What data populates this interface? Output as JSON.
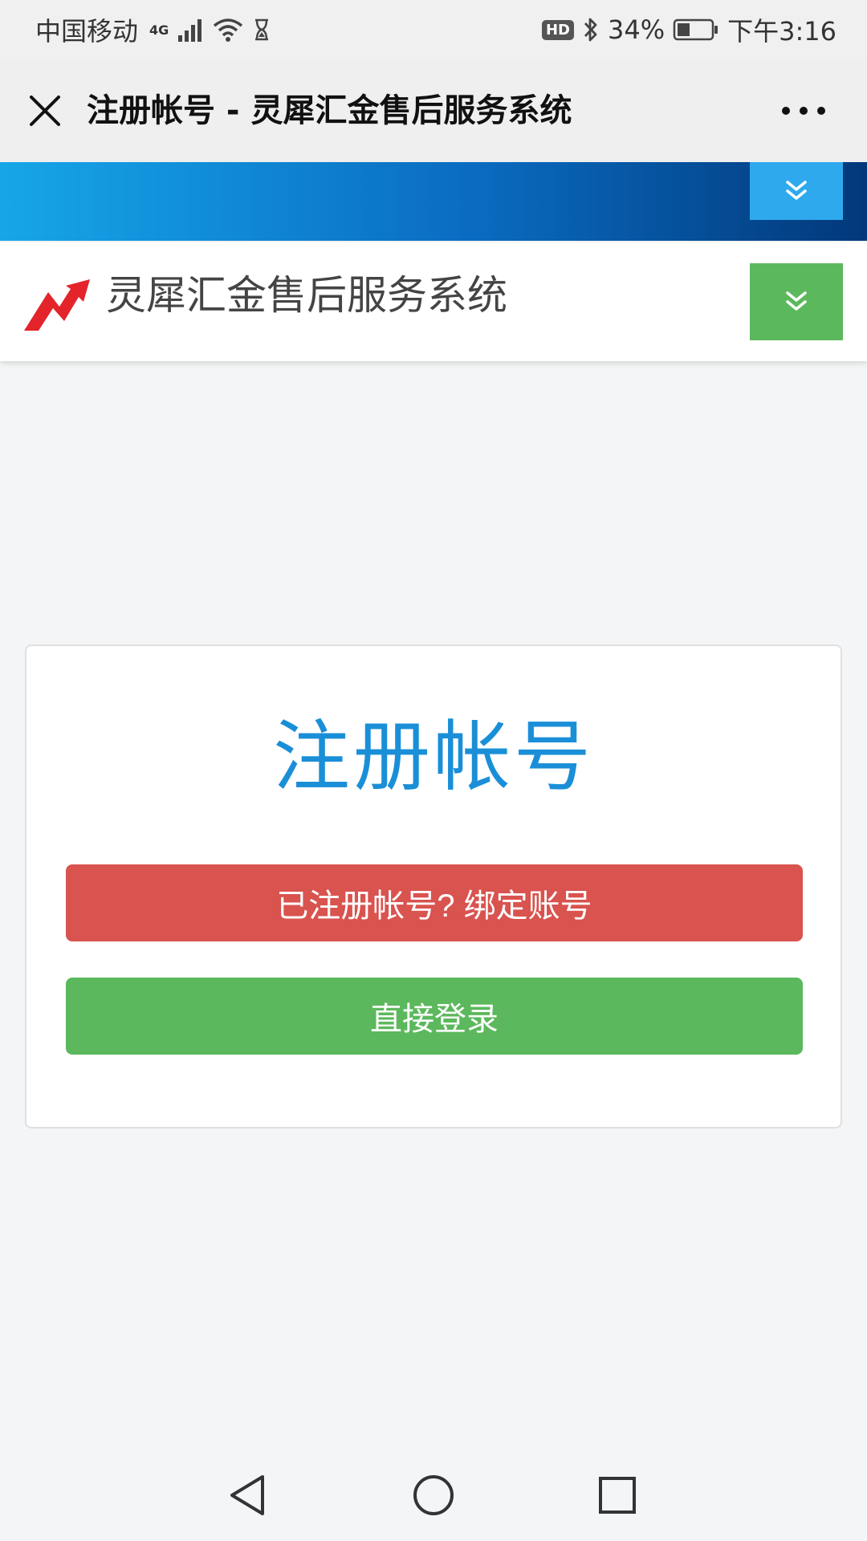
{
  "status_bar": {
    "carrier": "中国移动",
    "network": "4G",
    "hd": "HD",
    "battery": "34%",
    "time": "下午3:16",
    "icons": [
      "signal-icon",
      "wifi-icon",
      "hourglass-icon",
      "bluetooth-icon",
      "battery-icon"
    ]
  },
  "nav": {
    "title": "注册帐号 - 灵犀汇金售后服务系统",
    "close_icon": "close-icon",
    "more_icon": "more-icon"
  },
  "header": {
    "site_name": "灵犀汇金售后服务系统",
    "logo_color": "#e3242b",
    "toggle_color": "#5cb85c"
  },
  "card": {
    "title": "注册帐号",
    "title_color": "#1a8fd8",
    "bind_button": "已注册帐号? 绑定账号",
    "login_button": "直接登录",
    "bind_color": "#d9534f",
    "login_color": "#5cb85c"
  },
  "system_nav": {
    "icons": [
      "back-icon",
      "home-icon",
      "recents-icon"
    ]
  }
}
